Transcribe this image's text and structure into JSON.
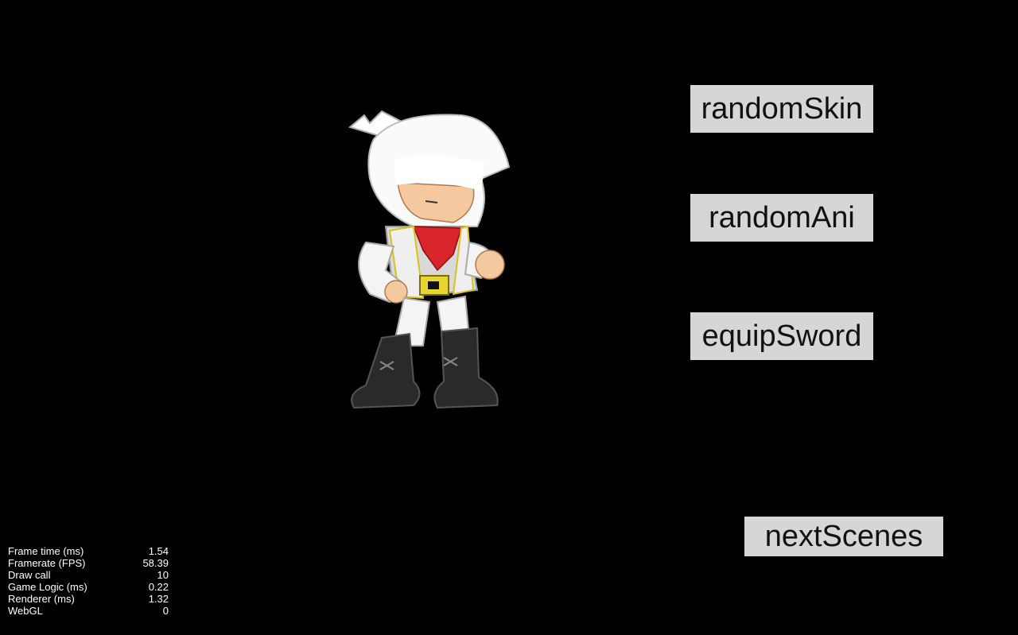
{
  "buttons": {
    "random_skin": "randomSkin",
    "random_ani": "randomAni",
    "equip_sword": "equipSword",
    "next_scenes": "nextScenes"
  },
  "stats": [
    {
      "label": "Frame time (ms)",
      "value": "1.54"
    },
    {
      "label": "Framerate (FPS)",
      "value": "58.39"
    },
    {
      "label": "Draw call",
      "value": "10"
    },
    {
      "label": "Game Logic (ms)",
      "value": "0.22"
    },
    {
      "label": "Renderer (ms)",
      "value": "1.32"
    },
    {
      "label": "WebGL",
      "value": "0"
    }
  ],
  "colors": {
    "background": "#000000",
    "button_bg": "#d6d6d6",
    "button_text": "#111111",
    "stats_text": "#ffffff"
  },
  "character": {
    "icon": "ninja-character-sprite"
  }
}
